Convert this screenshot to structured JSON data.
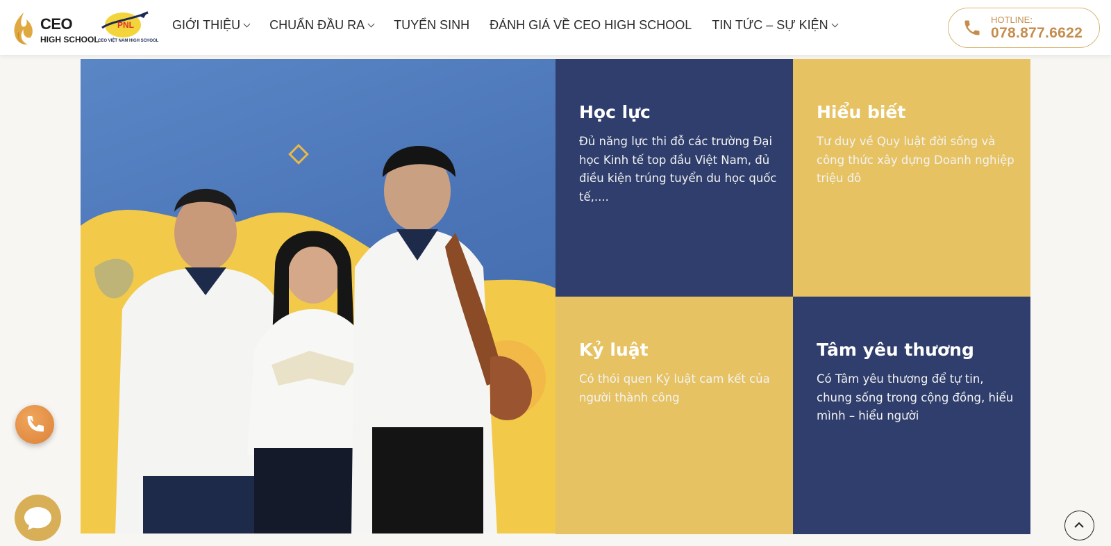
{
  "header": {
    "logo": {
      "line1": "CEO",
      "line2": "HIGH SCHOOL",
      "partner_text": "PNL",
      "partner_sub": "CEO VIỆT NAM HIGH SCHOOL"
    },
    "nav": [
      {
        "label": "GIỚI THIỆU",
        "has_dropdown": true
      },
      {
        "label": "CHUẨN ĐẦU RA",
        "has_dropdown": true
      },
      {
        "label": "TUYỂN SINH",
        "has_dropdown": false
      },
      {
        "label": "ĐÁNH GIÁ VỀ CEO HIGH SCHOOL",
        "has_dropdown": false
      },
      {
        "label": "TIN TỨC – SỰ KIỆN",
        "has_dropdown": true
      }
    ],
    "hotline": {
      "label": "HOTLINE:",
      "number": "078.877.6622",
      "icon": "phone-icon"
    }
  },
  "tiles": [
    {
      "title": "Học lực",
      "description": "Đủ năng lực thi đỗ các trường Đại học Kinh tế top đầu Việt Nam, đủ điều kiện trúng tuyển du học quốc tế,...."
    },
    {
      "title": "Hiểu biết",
      "description": "Tư duy về Quy luật đời sống và công thức xây dựng Doanh nghiệp triệu đô"
    },
    {
      "title": "Kỷ luật",
      "description": "Có thói quen Kỷ luật cam kết của người thành công"
    },
    {
      "title": "Tâm yêu thương",
      "description": "Có Tâm yêu thương để tự tin, chung sống trong cộng đồng, hiểu mình – hiểu người"
    }
  ],
  "colors": {
    "navy": "#2f3e6c",
    "yellow": "#e6c262",
    "accent": "#c48d4e",
    "hero_blue": "#4a74b6"
  },
  "floating": {
    "call_icon": "phone-icon",
    "chat_icon": "chat-bubble-icon",
    "scroll_icon": "chevron-up-icon"
  }
}
